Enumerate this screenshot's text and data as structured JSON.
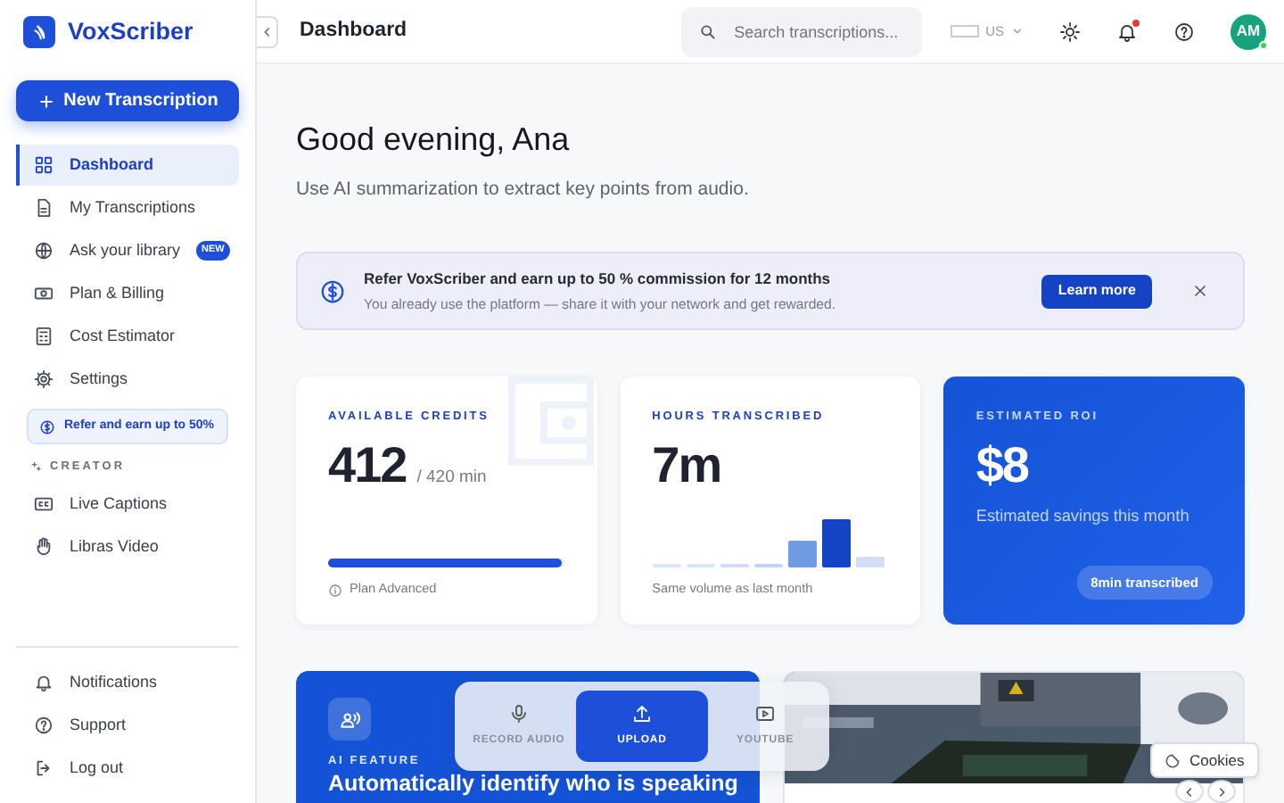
{
  "sidebar": {
    "brand": "VoxScriber",
    "new_button": "New Transcription",
    "items": [
      {
        "label": "Dashboard",
        "selected": true
      },
      {
        "label": "My Transcriptions",
        "selected": false
      },
      {
        "label": "Ask your library",
        "selected": false,
        "badge": "NEW"
      },
      {
        "label": "Plan & Billing",
        "selected": false
      },
      {
        "label": "Cost Estimator",
        "selected": false
      },
      {
        "label": "Settings",
        "selected": false
      }
    ],
    "referral": "Refer and earn up to 50%",
    "section_label": "CREATOR",
    "creator_items": [
      {
        "label": "Live Captions",
        "selected": false
      },
      {
        "label": "Libras Video",
        "selected": false
      }
    ],
    "footer_items": [
      {
        "label": "Notifications"
      },
      {
        "label": "Support"
      },
      {
        "label": "Log out"
      }
    ]
  },
  "header": {
    "title": "Dashboard",
    "search_placeholder": "Search transcriptions...",
    "locale": "US",
    "avatar": "AM",
    "online": true,
    "unread": true
  },
  "greeting": "Good evening, Ana",
  "subtitle": "Use AI summarization to extract key points from audio.",
  "banner": {
    "title": "Refer VoxScriber and earn up to 50 % commission for 12 months",
    "text": "You already use the platform — share it with your network and get rewarded.",
    "button": "Learn more"
  },
  "stats": {
    "credits": {
      "label": "AVAILABLE CREDITS",
      "value": "412",
      "unit": "/ 420 min",
      "level": 0.99,
      "note": "Plan Advanced"
    },
    "hours": {
      "label": "HOURS TRANSCRIBED",
      "value": "7m",
      "note": "Same volume as last month"
    },
    "roi": {
      "label": "ESTIMATED ROI",
      "value": "$8",
      "text": "Estimated savings this month",
      "pill": "8min transcribed"
    }
  },
  "feature": {
    "kicker": "AI FEATURE",
    "title": "Automatically identify who is speaking"
  },
  "input_modes": [
    {
      "label": "RECORD AUDIO",
      "selected": false
    },
    {
      "label": "UPLOAD",
      "selected": true
    },
    {
      "label": "YOUTUBE",
      "selected": false
    }
  ],
  "cookies": "Cookies"
}
